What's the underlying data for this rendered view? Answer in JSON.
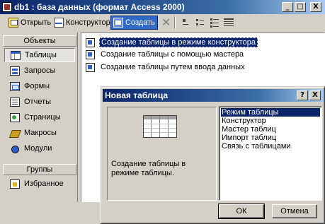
{
  "window": {
    "title": "db1 : база данных (формат Access 2000)",
    "buttons": {
      "minimize": "_",
      "maximize": "□",
      "close": "X"
    }
  },
  "toolbar": {
    "open_label": "Открыть",
    "design_label": "Конструктор",
    "new_label": "Создать",
    "delete_symbol": "✕"
  },
  "objects_pane": {
    "header": "Объекты",
    "items": [
      {
        "label": "Таблицы",
        "icon": "table-icon",
        "selected": true
      },
      {
        "label": "Запросы",
        "icon": "query-icon"
      },
      {
        "label": "Формы",
        "icon": "form-icon"
      },
      {
        "label": "Отчеты",
        "icon": "report-icon"
      },
      {
        "label": "Страницы",
        "icon": "page-icon"
      },
      {
        "label": "Макросы",
        "icon": "macro-icon"
      },
      {
        "label": "Модули",
        "icon": "module-icon"
      }
    ],
    "groups_header": "Группы",
    "group_items": [
      {
        "label": "Избранное",
        "icon": "favorites-icon"
      }
    ]
  },
  "content_list": {
    "items": [
      {
        "label": "Создание таблицы в режиме конструктора",
        "selected": true
      },
      {
        "label": "Создание таблицы с помощью мастера"
      },
      {
        "label": "Создание таблицы путем ввода данных"
      }
    ]
  },
  "dialog": {
    "title": "Новая таблица",
    "help_button": "?",
    "close_button": "X",
    "description": "Создание таблицы в режиме таблицы.",
    "options": [
      {
        "label": "Режим таблицы",
        "selected": true
      },
      {
        "label": "Конструктор"
      },
      {
        "label": "Мастер таблиц"
      },
      {
        "label": "Импорт таблиц"
      },
      {
        "label": "Связь с таблицами"
      }
    ],
    "ok_label": "ОК",
    "cancel_label": "Отмена"
  },
  "colors": {
    "title_active": "#0a246a",
    "selection": "#0a246a",
    "face": "#d4d0c8"
  }
}
